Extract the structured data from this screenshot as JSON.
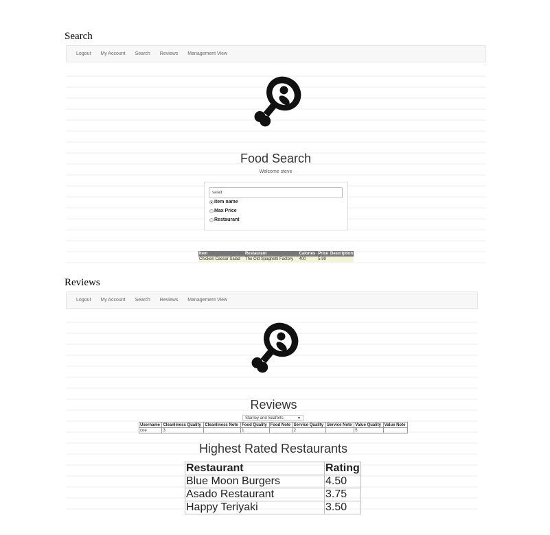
{
  "nav": {
    "links": [
      "Logout",
      "My Account",
      "Search",
      "Reviews",
      "Management View"
    ]
  },
  "search_section": {
    "heading": "Search",
    "title": "Food Search",
    "welcome": "Welcome steve",
    "query": "salad",
    "options": [
      {
        "label": "Item name",
        "selected": true
      },
      {
        "label": "Max Price",
        "selected": false
      },
      {
        "label": "Restaurant",
        "selected": false
      }
    ],
    "results": {
      "headers": [
        "Item",
        "Restaurant",
        "Calories",
        "Price",
        "Description"
      ],
      "rows": [
        [
          "Chicken Caesar Salad",
          "The Old Spaghetti Factory",
          "400",
          "5.99",
          ""
        ]
      ]
    }
  },
  "reviews_section": {
    "heading": "Reviews",
    "title": "Reviews",
    "selected_restaurant": "Stanley and Seaforts",
    "table": {
      "headers": [
        "Username",
        "Cleanliness Quality",
        "Cleanliness Note",
        "Food Quality",
        "Food Note",
        "Service Quality",
        "Service Note",
        "Value Quality",
        "Value Note"
      ],
      "rows": [
        [
          "coe",
          "3",
          "",
          "1",
          "",
          "2",
          "",
          "5",
          ""
        ]
      ]
    },
    "highest_rated": {
      "title": "Highest Rated Restaurants",
      "headers": [
        "Restaurant",
        "Rating"
      ],
      "rows": [
        [
          "Blue Moon Burgers",
          "4.50"
        ],
        [
          "Asado Restaurant",
          "3.75"
        ],
        [
          "Happy Teriyaki",
          "3.50"
        ]
      ]
    }
  },
  "icons": {
    "logo": "meat-drumstick-icon",
    "select_arrow": "caret-down-icon"
  }
}
